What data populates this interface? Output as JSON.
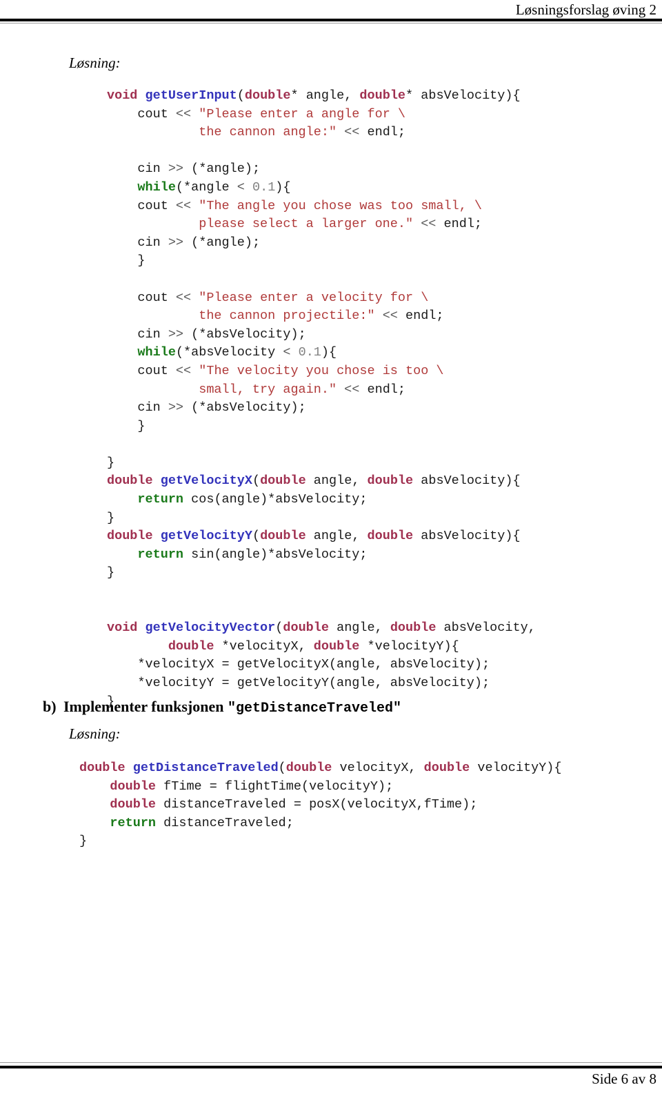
{
  "header": {
    "title": "Løsningsforslag øving 2"
  },
  "footer": {
    "page_label": "Side 6 av 8"
  },
  "content": {
    "solution_label_a": "Løsning:",
    "solution_label_b": "Løsning:",
    "part_b": {
      "marker": "b)",
      "text_before": "Implementer funksjonen ",
      "quote_open": "\"",
      "function_name": "getDistanceTraveled",
      "quote_close": "\""
    }
  },
  "code_a": {
    "lines": [
      [
        {
          "t": "void",
          "c": "kw-type"
        },
        {
          "t": " ",
          "c": "plain"
        },
        {
          "t": "getUserInput",
          "c": "fn"
        },
        {
          "t": "(",
          "c": "plain"
        },
        {
          "t": "double",
          "c": "kw-type"
        },
        {
          "t": "* angle, ",
          "c": "plain"
        },
        {
          "t": "double",
          "c": "kw-type"
        },
        {
          "t": "* absVelocity){",
          "c": "plain"
        }
      ],
      [
        {
          "t": "    cout ",
          "c": "plain"
        },
        {
          "t": "<<",
          "c": "op"
        },
        {
          "t": " ",
          "c": "plain"
        },
        {
          "t": "\"Please enter a angle for \\",
          "c": "str"
        }
      ],
      [
        {
          "t": "            the cannon angle:\"",
          "c": "str"
        },
        {
          "t": " ",
          "c": "plain"
        },
        {
          "t": "<<",
          "c": "op"
        },
        {
          "t": " endl;",
          "c": "plain"
        }
      ],
      [],
      [
        {
          "t": "    cin ",
          "c": "plain"
        },
        {
          "t": ">>",
          "c": "op"
        },
        {
          "t": " (*angle);",
          "c": "plain"
        }
      ],
      [
        {
          "t": "    ",
          "c": "plain"
        },
        {
          "t": "while",
          "c": "kw-ctrl"
        },
        {
          "t": "(*angle ",
          "c": "plain"
        },
        {
          "t": "<",
          "c": "op"
        },
        {
          "t": " ",
          "c": "plain"
        },
        {
          "t": "0.1",
          "c": "num"
        },
        {
          "t": "){",
          "c": "plain"
        }
      ],
      [
        {
          "t": "    cout ",
          "c": "plain"
        },
        {
          "t": "<<",
          "c": "op"
        },
        {
          "t": " ",
          "c": "plain"
        },
        {
          "t": "\"The angle you chose was too small, \\",
          "c": "str"
        }
      ],
      [
        {
          "t": "            please select a larger one.\"",
          "c": "str"
        },
        {
          "t": " ",
          "c": "plain"
        },
        {
          "t": "<<",
          "c": "op"
        },
        {
          "t": " endl;",
          "c": "plain"
        }
      ],
      [
        {
          "t": "    cin ",
          "c": "plain"
        },
        {
          "t": ">>",
          "c": "op"
        },
        {
          "t": " (*angle);",
          "c": "plain"
        }
      ],
      [
        {
          "t": "    }",
          "c": "plain"
        }
      ],
      [],
      [
        {
          "t": "    cout ",
          "c": "plain"
        },
        {
          "t": "<<",
          "c": "op"
        },
        {
          "t": " ",
          "c": "plain"
        },
        {
          "t": "\"Please enter a velocity for \\",
          "c": "str"
        }
      ],
      [
        {
          "t": "            the cannon projectile:\"",
          "c": "str"
        },
        {
          "t": " ",
          "c": "plain"
        },
        {
          "t": "<<",
          "c": "op"
        },
        {
          "t": " endl;",
          "c": "plain"
        }
      ],
      [
        {
          "t": "    cin ",
          "c": "plain"
        },
        {
          "t": ">>",
          "c": "op"
        },
        {
          "t": " (*absVelocity);",
          "c": "plain"
        }
      ],
      [
        {
          "t": "    ",
          "c": "plain"
        },
        {
          "t": "while",
          "c": "kw-ctrl"
        },
        {
          "t": "(*absVelocity ",
          "c": "plain"
        },
        {
          "t": "<",
          "c": "op"
        },
        {
          "t": " ",
          "c": "plain"
        },
        {
          "t": "0.1",
          "c": "num"
        },
        {
          "t": "){",
          "c": "plain"
        }
      ],
      [
        {
          "t": "    cout ",
          "c": "plain"
        },
        {
          "t": "<<",
          "c": "op"
        },
        {
          "t": " ",
          "c": "plain"
        },
        {
          "t": "\"The velocity you chose is too \\",
          "c": "str"
        }
      ],
      [
        {
          "t": "            small, try again.\"",
          "c": "str"
        },
        {
          "t": " ",
          "c": "plain"
        },
        {
          "t": "<<",
          "c": "op"
        },
        {
          "t": " endl;",
          "c": "plain"
        }
      ],
      [
        {
          "t": "    cin ",
          "c": "plain"
        },
        {
          "t": ">>",
          "c": "op"
        },
        {
          "t": " (*absVelocity);",
          "c": "plain"
        }
      ],
      [
        {
          "t": "    }",
          "c": "plain"
        }
      ],
      [],
      [
        {
          "t": "}",
          "c": "plain"
        }
      ],
      [
        {
          "t": "double",
          "c": "kw-type"
        },
        {
          "t": " ",
          "c": "plain"
        },
        {
          "t": "getVelocityX",
          "c": "fn"
        },
        {
          "t": "(",
          "c": "plain"
        },
        {
          "t": "double",
          "c": "kw-type"
        },
        {
          "t": " angle, ",
          "c": "plain"
        },
        {
          "t": "double",
          "c": "kw-type"
        },
        {
          "t": " absVelocity){",
          "c": "plain"
        }
      ],
      [
        {
          "t": "    ",
          "c": "plain"
        },
        {
          "t": "return",
          "c": "kw-ctrl"
        },
        {
          "t": " cos(angle)*absVelocity;",
          "c": "plain"
        }
      ],
      [
        {
          "t": "}",
          "c": "plain"
        }
      ],
      [
        {
          "t": "double",
          "c": "kw-type"
        },
        {
          "t": " ",
          "c": "plain"
        },
        {
          "t": "getVelocityY",
          "c": "fn"
        },
        {
          "t": "(",
          "c": "plain"
        },
        {
          "t": "double",
          "c": "kw-type"
        },
        {
          "t": " angle, ",
          "c": "plain"
        },
        {
          "t": "double",
          "c": "kw-type"
        },
        {
          "t": " absVelocity){",
          "c": "plain"
        }
      ],
      [
        {
          "t": "    ",
          "c": "plain"
        },
        {
          "t": "return",
          "c": "kw-ctrl"
        },
        {
          "t": " sin(angle)*absVelocity;",
          "c": "plain"
        }
      ],
      [
        {
          "t": "}",
          "c": "plain"
        }
      ],
      [],
      [],
      [
        {
          "t": "void",
          "c": "kw-type"
        },
        {
          "t": " ",
          "c": "plain"
        },
        {
          "t": "getVelocityVector",
          "c": "fn"
        },
        {
          "t": "(",
          "c": "plain"
        },
        {
          "t": "double",
          "c": "kw-type"
        },
        {
          "t": " angle, ",
          "c": "plain"
        },
        {
          "t": "double",
          "c": "kw-type"
        },
        {
          "t": " absVelocity,",
          "c": "plain"
        }
      ],
      [
        {
          "t": "        ",
          "c": "plain"
        },
        {
          "t": "double",
          "c": "kw-type"
        },
        {
          "t": " *velocityX, ",
          "c": "plain"
        },
        {
          "t": "double",
          "c": "kw-type"
        },
        {
          "t": " *velocityY){",
          "c": "plain"
        }
      ],
      [
        {
          "t": "    *velocityX = getVelocityX(angle, absVelocity);",
          "c": "plain"
        }
      ],
      [
        {
          "t": "    *velocityY = getVelocityY(angle, absVelocity);",
          "c": "plain"
        }
      ],
      [
        {
          "t": "}",
          "c": "plain"
        }
      ]
    ]
  },
  "code_b": {
    "lines": [
      [
        {
          "t": "double",
          "c": "kw-type"
        },
        {
          "t": " ",
          "c": "plain"
        },
        {
          "t": "getDistanceTraveled",
          "c": "fn"
        },
        {
          "t": "(",
          "c": "plain"
        },
        {
          "t": "double",
          "c": "kw-type"
        },
        {
          "t": " velocityX, ",
          "c": "plain"
        },
        {
          "t": "double",
          "c": "kw-type"
        },
        {
          "t": " velocityY){",
          "c": "plain"
        }
      ],
      [
        {
          "t": "    ",
          "c": "plain"
        },
        {
          "t": "double",
          "c": "kw-type"
        },
        {
          "t": " fTime = flightTime(velocityY);",
          "c": "plain"
        }
      ],
      [
        {
          "t": "    ",
          "c": "plain"
        },
        {
          "t": "double",
          "c": "kw-type"
        },
        {
          "t": " distanceTraveled = posX(velocityX,fTime);",
          "c": "plain"
        }
      ],
      [
        {
          "t": "    ",
          "c": "plain"
        },
        {
          "t": "return",
          "c": "kw-ctrl"
        },
        {
          "t": " distanceTraveled;",
          "c": "plain"
        }
      ],
      [
        {
          "t": "}",
          "c": "plain"
        }
      ]
    ]
  },
  "colors": {
    "keyword_type": "#A03050",
    "keyword_control": "#1A7A1A",
    "function_name": "#3333BB",
    "string_literal": "#B03A3A",
    "number_literal": "#808080",
    "operator": "#5A5A5A",
    "plain_text": "#1A1A1A",
    "rule": "#000000"
  }
}
